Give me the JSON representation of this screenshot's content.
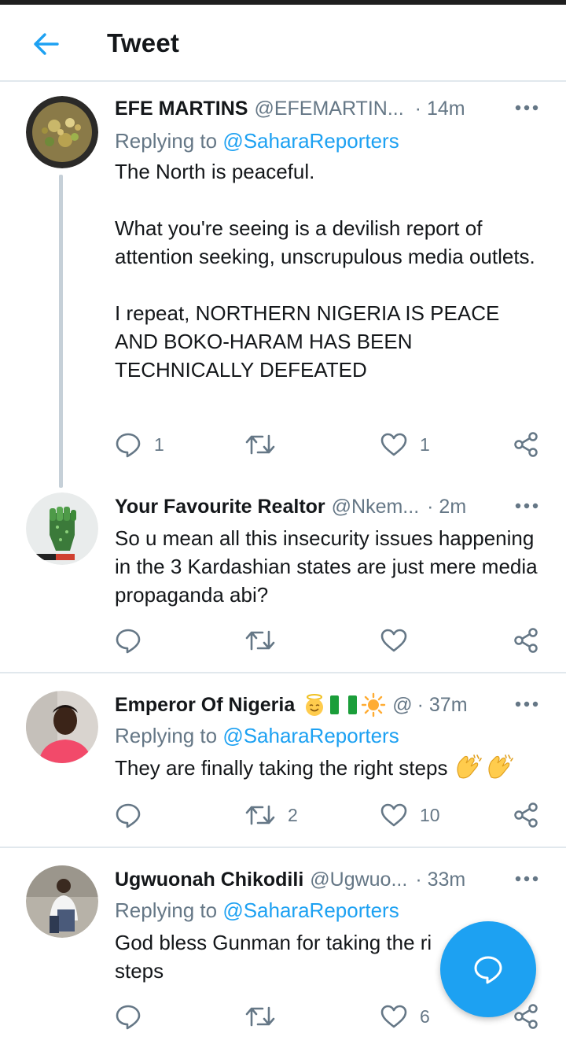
{
  "header": {
    "title": "Tweet"
  },
  "tweets": [
    {
      "name": "EFE MARTINS",
      "handle": "@EFEMARTIN...",
      "time": "· 14m",
      "replying_prefix": "Replying to ",
      "replying_to": "@SaharaReporters",
      "text": "The North is peaceful.\n\nWhat you're seeing is a devilish report of attention seeking, unscrupulous media outlets.\n\nI repeat, NORTHERN NIGERIA IS PEACE AND BOKO-HARAM HAS BEEN TECHNICALLY DEFEATED",
      "reply_count": "1",
      "retweet_count": "",
      "like_count": "1"
    },
    {
      "name": "Your Favourite Realtor",
      "handle": "@Nkem...",
      "time": "· 2m",
      "text": "So u mean all this insecurity issues happening in the 3 Kardashian states are just mere media propaganda abi?",
      "reply_count": "",
      "retweet_count": "",
      "like_count": ""
    },
    {
      "name": "Emperor Of Nigeria",
      "handle": "@",
      "time": "· 37m",
      "replying_prefix": "Replying to ",
      "replying_to": "@SaharaReporters",
      "text": "They are finally taking the right steps",
      "reply_count": "",
      "retweet_count": "2",
      "like_count": "10"
    },
    {
      "name": "Ugwuonah Chikodili",
      "handle": "@Ugwuo...",
      "time": "· 33m",
      "replying_prefix": "Replying to ",
      "replying_to": "@SaharaReporters",
      "text": "God bless Gunman for taking the ri\nsteps",
      "reply_count": "",
      "retweet_count": "",
      "like_count": "6"
    }
  ],
  "colors": {
    "accent": "#1da1f2",
    "secondary_text": "#657786",
    "divider": "#e1e8ed"
  },
  "icons": {
    "back": "arrow-left-icon",
    "more": "more-dots-icon",
    "reply": "speech-bubble-icon",
    "retweet": "retweet-icon",
    "like": "heart-icon",
    "share": "share-icon",
    "compose": "compose-reply-icon"
  }
}
